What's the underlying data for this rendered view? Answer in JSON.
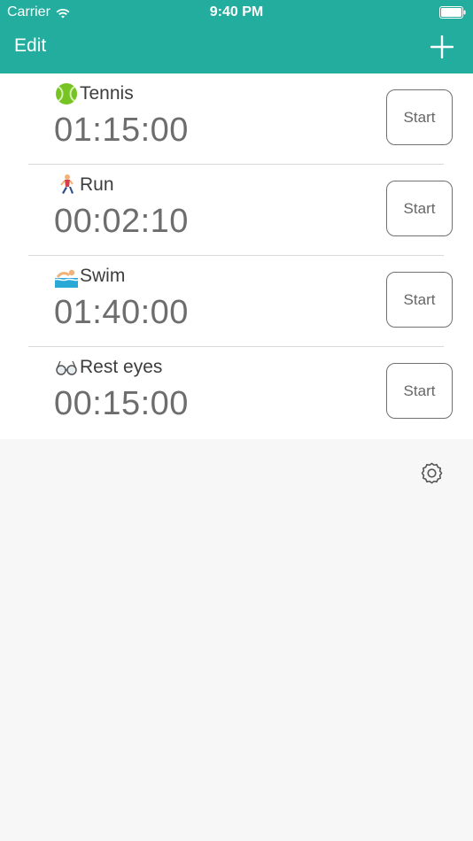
{
  "status_bar": {
    "carrier": "Carrier",
    "time": "9:40 PM",
    "wifi_icon": "wifi-icon",
    "battery_icon": "battery-icon"
  },
  "nav": {
    "edit_label": "Edit",
    "add_icon": "plus-icon",
    "header_color": "#23ad9e"
  },
  "timers": [
    {
      "name": "Tennis",
      "time": "01:15:00",
      "button": "Start",
      "icon": "tennis-ball-icon"
    },
    {
      "name": "Run",
      "time": "00:02:10",
      "button": "Start",
      "icon": "runner-icon"
    },
    {
      "name": "Swim",
      "time": "01:40:00",
      "button": "Start",
      "icon": "swimmer-icon"
    },
    {
      "name": "Rest eyes",
      "time": "00:15:00",
      "button": "Start",
      "icon": "glasses-icon"
    }
  ],
  "settings_icon": "gear-icon"
}
